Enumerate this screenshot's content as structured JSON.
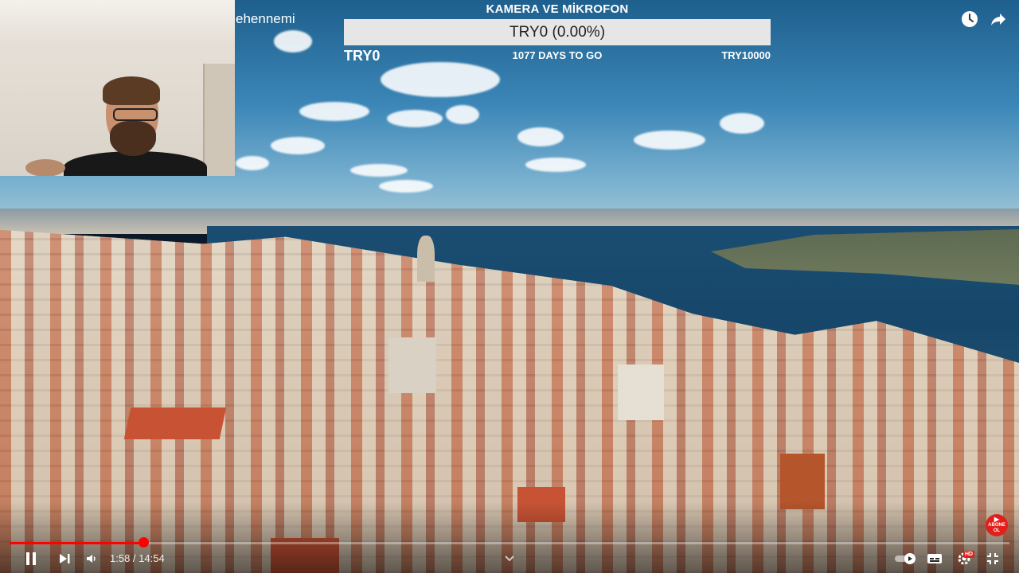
{
  "video": {
    "partial_title": "ehennemi"
  },
  "goal": {
    "title": "KAMERA VE MİKROFON",
    "current_label": "TRY0 (0.00%)",
    "progress_fraction": 0.0,
    "start_label": "TRY0",
    "days_label": "1077 DAYS TO GO",
    "end_label": "TRY10000"
  },
  "top_actions": {
    "watch_later_icon": "clock-icon",
    "share_icon": "share-arrow-icon"
  },
  "player": {
    "progress_fraction": 0.134,
    "time_current": "1:58",
    "time_separator": " / ",
    "time_total": "14:54",
    "time_display": "1:58 / 14:54",
    "subscribe_badge": [
      "ABONE",
      "OL"
    ],
    "hd_badge": "HD",
    "accent_color": "#ff0000"
  }
}
